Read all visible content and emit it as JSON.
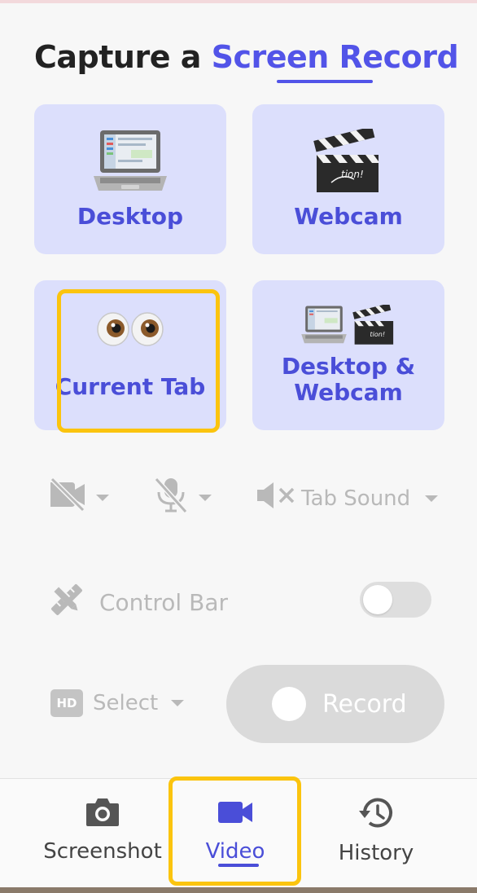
{
  "title": {
    "prefix": "Capture a",
    "highlight": "Screen Record"
  },
  "sources": [
    {
      "label": "Desktop",
      "icon": "laptop-icon"
    },
    {
      "label": "Webcam",
      "icon": "clapperboard-icon"
    },
    {
      "label": "Current Tab",
      "icon": "eyes-icon",
      "selected": true
    },
    {
      "label": "Desktop & Webcam",
      "icon": "laptop-and-clapperboard-icon"
    }
  ],
  "controls": {
    "camera": {
      "icon": "camera-off-icon",
      "enabled": false
    },
    "mic": {
      "icon": "mic-off-icon",
      "enabled": false
    },
    "sound": {
      "label": "Tab Sound",
      "icon": "speaker-muted-icon"
    }
  },
  "control_bar": {
    "label": "Control Bar",
    "enabled": false
  },
  "quality": {
    "badge": "HD",
    "label": "Select"
  },
  "record": {
    "label": "Record"
  },
  "nav": [
    {
      "label": "Screenshot",
      "icon": "camera-icon"
    },
    {
      "label": "Video",
      "icon": "video-icon",
      "active": true
    },
    {
      "label": "History",
      "icon": "history-icon"
    }
  ],
  "colors": {
    "accent": "#5254e8",
    "tile_bg": "#dcdffc",
    "highlight_frame": "#fbc40e",
    "disabled": "#b9b9b9"
  }
}
